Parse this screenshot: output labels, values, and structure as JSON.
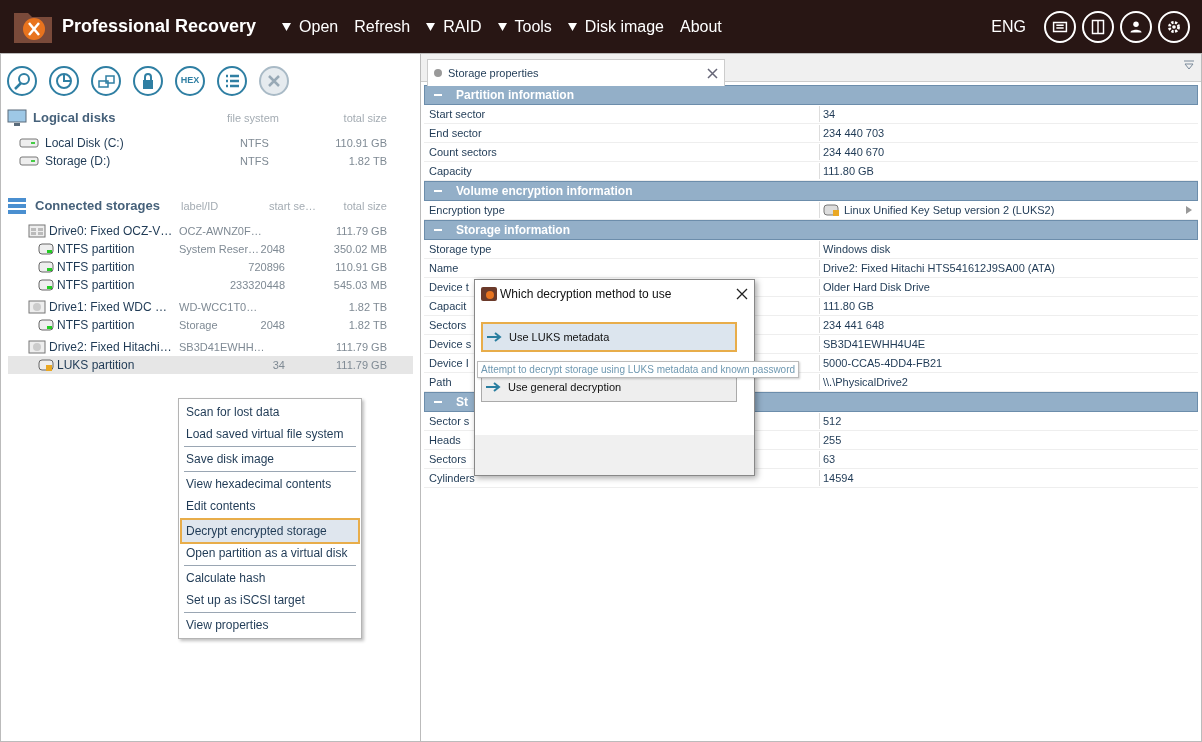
{
  "app": {
    "title": "Professional Recovery",
    "language": "ENG"
  },
  "menu": [
    {
      "label": "Open",
      "dropdown": true
    },
    {
      "label": "Refresh",
      "dropdown": false
    },
    {
      "label": "RAID",
      "dropdown": true
    },
    {
      "label": "Tools",
      "dropdown": true
    },
    {
      "label": "Disk image",
      "dropdown": true
    },
    {
      "label": "About",
      "dropdown": false
    }
  ],
  "header_buttons": [
    {
      "kind": "panel"
    },
    {
      "kind": "split"
    },
    {
      "kind": "user"
    },
    {
      "kind": "gear"
    }
  ],
  "toolbar": [
    {
      "kind": "search",
      "disabled": false
    },
    {
      "kind": "chart",
      "disabled": false
    },
    {
      "kind": "copy",
      "disabled": false
    },
    {
      "kind": "lock",
      "disabled": false
    },
    {
      "kind": "hex",
      "label": "HEX",
      "disabled": false
    },
    {
      "kind": "list",
      "disabled": false
    },
    {
      "kind": "close",
      "disabled": true
    }
  ],
  "logical_disks": {
    "title": "Logical disks",
    "columns": [
      "file system",
      "total size"
    ],
    "items": [
      {
        "name": "Local Disk (C:)",
        "file_system": "NTFS",
        "size": "110.91 GB"
      },
      {
        "name": "Storage (D:)",
        "file_system": "NTFS",
        "size": "1.82 TB"
      }
    ]
  },
  "connected_storages": {
    "title": "Connected storages",
    "columns": [
      "label/ID",
      "start se…",
      "total size"
    ],
    "items": [
      {
        "kind": "array",
        "name": "Drive0: Fixed OCZ-V…",
        "label": "OCZ-AWNZ0F…",
        "size": "111.79 GB",
        "selected": false,
        "children": [
          {
            "kind": "ntfs",
            "name": "NTFS partition",
            "label": "System Reser…",
            "start": "2048",
            "size": "350.02 MB",
            "selected": false
          },
          {
            "kind": "ntfs",
            "name": "NTFS partition",
            "start": "720896",
            "size": "110.91 GB",
            "selected": false
          },
          {
            "kind": "ntfs",
            "name": "NTFS partition",
            "start": "233320448",
            "size": "545.03 MB",
            "selected": false
          }
        ]
      },
      {
        "kind": "disk",
        "name": "Drive1: Fixed WDC …",
        "label": "WD-WCC1T0…",
        "size": "1.82 TB",
        "selected": false,
        "children": [
          {
            "kind": "ntfs",
            "name": "NTFS partition",
            "label": "Storage",
            "start": "2048",
            "size": "1.82 TB",
            "selected": false
          }
        ]
      },
      {
        "kind": "disk",
        "name": "Drive2: Fixed Hitachi…",
        "label": "SB3D41EWHH…",
        "size": "111.79 GB",
        "selected": false,
        "children": [
          {
            "kind": "luks",
            "name": "LUKS partition",
            "start": "34",
            "size": "111.79 GB",
            "selected": true
          }
        ]
      }
    ]
  },
  "context_menu": [
    [
      {
        "label": "Scan for lost data",
        "selected": false
      },
      {
        "label": "Load saved virtual file system",
        "selected": false
      }
    ],
    [
      {
        "label": "Save disk image",
        "selected": false
      }
    ],
    [
      {
        "label": "View hexadecimal contents",
        "selected": false
      },
      {
        "label": "Edit contents",
        "selected": false
      }
    ],
    [
      {
        "label": "Decrypt encrypted storage",
        "selected": true
      },
      {
        "label": "Open partition as a virtual disk",
        "selected": false
      }
    ],
    [
      {
        "label": "Calculate hash",
        "selected": false
      },
      {
        "label": "Set up as iSCSI target",
        "selected": false
      }
    ],
    [
      {
        "label": "View properties",
        "selected": false
      }
    ]
  ],
  "tab": {
    "label": "Storage properties",
    "selected": true
  },
  "properties": [
    {
      "title": "Partition information",
      "expanded": true,
      "rows": [
        {
          "label": "Start sector",
          "value": "34"
        },
        {
          "label": "End sector",
          "value": "234 440 703"
        },
        {
          "label": "Count sectors",
          "value": "234 440 670"
        },
        {
          "label": "Capacity",
          "value": "111.80 GB"
        }
      ]
    },
    {
      "title": "Volume encryption information",
      "expanded": true,
      "rows": [
        {
          "label": "Encryption type",
          "value": "Linux Unified Key Setup version 2 (LUKS2)",
          "kind": "encryption"
        }
      ]
    },
    {
      "title": "Storage information",
      "expanded": true,
      "rows": [
        {
          "label": "Storage type",
          "value": "Windows disk"
        },
        {
          "label": "Name",
          "value": "Drive2: Fixed Hitachi HTS541612J9SA00 (ATA)"
        },
        {
          "label": "Device t",
          "value": "Older Hard Disk Drive"
        },
        {
          "label": "Capacit",
          "value": "111.80 GB"
        },
        {
          "label": "Sectors",
          "value": "234 441 648"
        },
        {
          "label": "Device s",
          "value": "SB3D41EWHH4U4E"
        },
        {
          "label": "Device I",
          "value": "5000-CCA5-4DD4-FB21"
        },
        {
          "label": "Path",
          "value": "\\\\.\\PhysicalDrive2"
        }
      ]
    },
    {
      "title": "St",
      "expanded": true,
      "rows": [
        {
          "label": "Sector s",
          "value": "512"
        },
        {
          "label": "Heads",
          "value": "255"
        },
        {
          "label": "Sectors",
          "value": "63"
        },
        {
          "label": "Cylinders",
          "value": "14594"
        }
      ]
    }
  ],
  "dialog": {
    "title": "Which decryption method to use",
    "options": [
      {
        "label": "Use LUKS metadata",
        "selected": true
      },
      {
        "label": "Use general decryption",
        "selected": false
      }
    ],
    "tooltip": "Attempt to decrypt storage using LUKS metadata and known password"
  }
}
